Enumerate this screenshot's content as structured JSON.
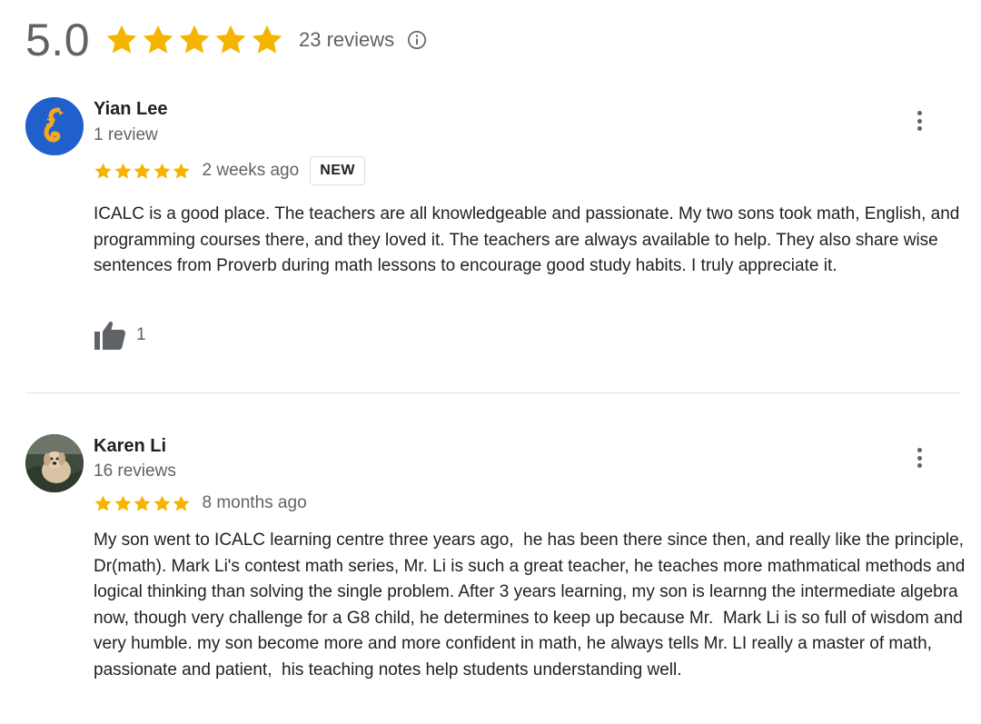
{
  "summary": {
    "rating": "5.0",
    "stars": 5,
    "count_label": "23 reviews",
    "star_color": "#f4b400"
  },
  "reviews": [
    {
      "name": "Yian Lee",
      "subcount": "1 review",
      "stars": 5,
      "when": "2 weeks ago",
      "badge": "NEW",
      "text": "ICALC is a good place. The teachers are all knowledgeable and passionate. My two sons took math, English, and programming courses there, and they loved it. The teachers are always available to help. They also share wise sentences from Proverb during math lessons to encourage good study habits. I truly appreciate it.",
      "helpful_count": "1",
      "avatar_icon": "seahorse-icon"
    },
    {
      "name": "Karen Li",
      "subcount": "16 reviews",
      "stars": 5,
      "when": "8 months ago",
      "text": "My son went to ICALC learning centre three years ago,  he has been there since then, and really like the principle, Dr(math). Mark Li's contest math series, Mr. Li is such a great teacher, he teaches more mathmatical methods and logical thinking than solving the single problem. After 3 years learning, my son is learnng the intermediate algebra now, though very challenge for a G8 child, he determines to keep up because Mr.  Mark Li is so full of wisdom and very humble. my son become more and more confident in math, he always tells Mr. LI really a master of math, passionate and patient,  his teaching notes help students understanding well.",
      "avatar_icon": "dog-photo"
    }
  ]
}
